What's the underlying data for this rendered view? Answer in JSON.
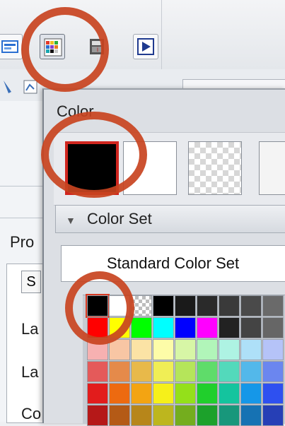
{
  "toolbar": {
    "buttons": [
      {
        "name": "layer-icon",
        "color": "#2a6fd1"
      },
      {
        "name": "color-palette-icon",
        "color": "#c93a2c"
      },
      {
        "name": "movie-icon",
        "color": "#333333"
      },
      {
        "name": "play-icon",
        "color": "#1f3a8f"
      }
    ]
  },
  "left_panel": {
    "header": "Pro",
    "tab": "S",
    "labels": [
      "La",
      "La",
      "Co"
    ]
  },
  "color_window": {
    "title": "Color",
    "main_color": "#000000",
    "sub_color": "#ffffff",
    "color_set_label": "Color Set",
    "color_set_value": "Standard Color Set"
  },
  "palette": {
    "rows": [
      [
        "#000000",
        "#ffffff",
        "checker",
        "#000000",
        "#1a1a1a",
        "#2a2a2a",
        "#3a3a3a",
        "#4a4a4a",
        "#6a6a6a"
      ],
      [
        "#ff0000",
        "#ffff00",
        "#00ff00",
        "#00ffff",
        "#0000ff",
        "#ff00ff",
        "#222222",
        "#444444",
        "#666666"
      ],
      [
        "#f7b1b1",
        "#f8c6a4",
        "#fbe3a5",
        "#fdfca8",
        "#d7f6a6",
        "#b1f5b9",
        "#aef3e3",
        "#aee0f8",
        "#b5c3f8"
      ],
      [
        "#e45a5a",
        "#e58a4a",
        "#e8b94a",
        "#f0ee55",
        "#b5e55a",
        "#5fdc6a",
        "#53d9bb",
        "#53b8ea",
        "#6b86ef"
      ],
      [
        "#e21c1c",
        "#ed6a10",
        "#f3a412",
        "#f6f01a",
        "#94e01a",
        "#20cf2c",
        "#14c49e",
        "#1597e8",
        "#2e50f0"
      ],
      [
        "#b51818",
        "#b45a16",
        "#b7861a",
        "#bdb61e",
        "#74ad1e",
        "#1ca12b",
        "#18977b",
        "#1672b3",
        "#263fb6"
      ]
    ]
  },
  "annotation": {
    "ring_color": "#c8431f"
  }
}
